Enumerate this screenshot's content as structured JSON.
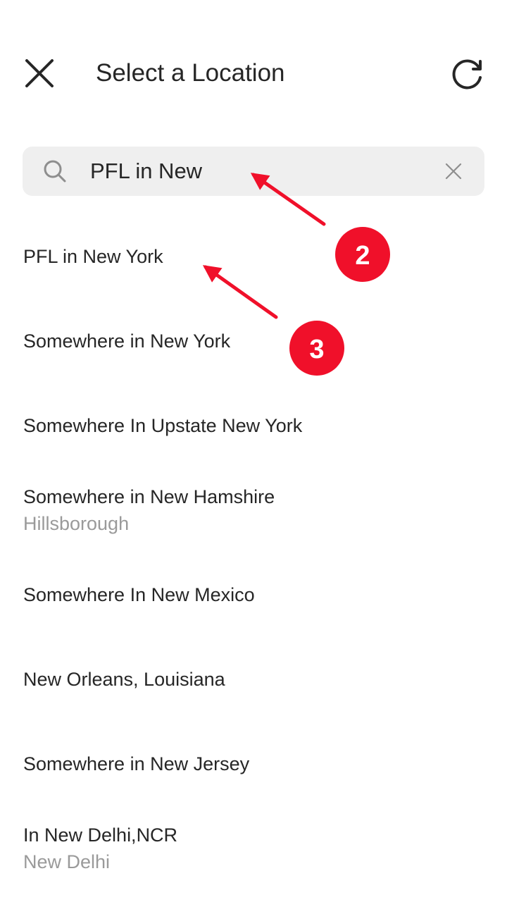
{
  "header": {
    "title": "Select a Location"
  },
  "search": {
    "value": "PFL in New",
    "placeholder": "Search"
  },
  "results": [
    {
      "title": "PFL in New York",
      "subtitle": ""
    },
    {
      "title": "Somewhere in New York",
      "subtitle": ""
    },
    {
      "title": "Somewhere In Upstate New York",
      "subtitle": ""
    },
    {
      "title": "Somewhere in New Hamshire",
      "subtitle": "Hillsborough"
    },
    {
      "title": "Somewhere In New Mexico",
      "subtitle": ""
    },
    {
      "title": "New Orleans, Louisiana",
      "subtitle": ""
    },
    {
      "title": "Somewhere in New Jersey",
      "subtitle": ""
    },
    {
      "title": "In New Delhi,NCR",
      "subtitle": "New Delhi"
    }
  ],
  "annotations": {
    "step_a": "2",
    "step_b": "3"
  },
  "colors": {
    "annotation_red": "#f0102a",
    "text_primary": "#262626",
    "text_secondary": "#9a9a9a",
    "search_background": "#efefef"
  },
  "icons": [
    "close-icon",
    "refresh-icon",
    "search-icon",
    "clear-icon"
  ]
}
